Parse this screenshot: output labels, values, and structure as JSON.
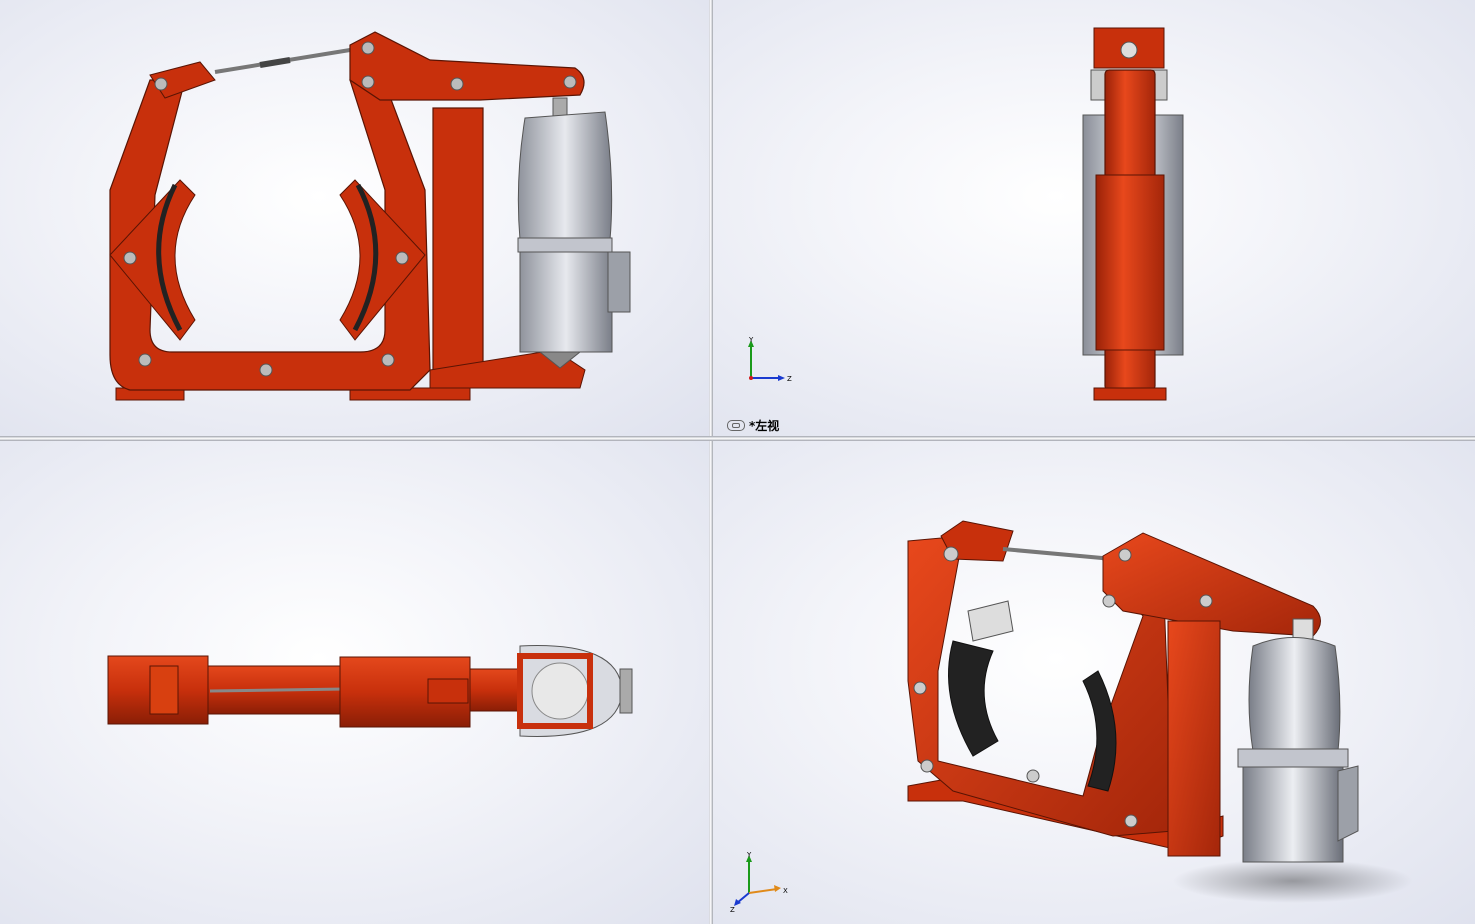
{
  "viewports": {
    "front": {
      "triad": null
    },
    "left": {
      "view_name": "*左视",
      "triad": {
        "y": "Y",
        "z": "Z"
      }
    },
    "top": {
      "triad": null
    },
    "iso": {
      "triad": {
        "y": "Y",
        "x": "X",
        "z": "Z"
      }
    }
  },
  "colors": {
    "frame_red": "#c8300c",
    "frame_dark": "#8a1e06",
    "frame_light": "#e4481c",
    "shoe_lining": "#222222",
    "motor_grey": "#b8bcc6",
    "motor_dark": "#6c707a",
    "background": "#eceef5"
  }
}
